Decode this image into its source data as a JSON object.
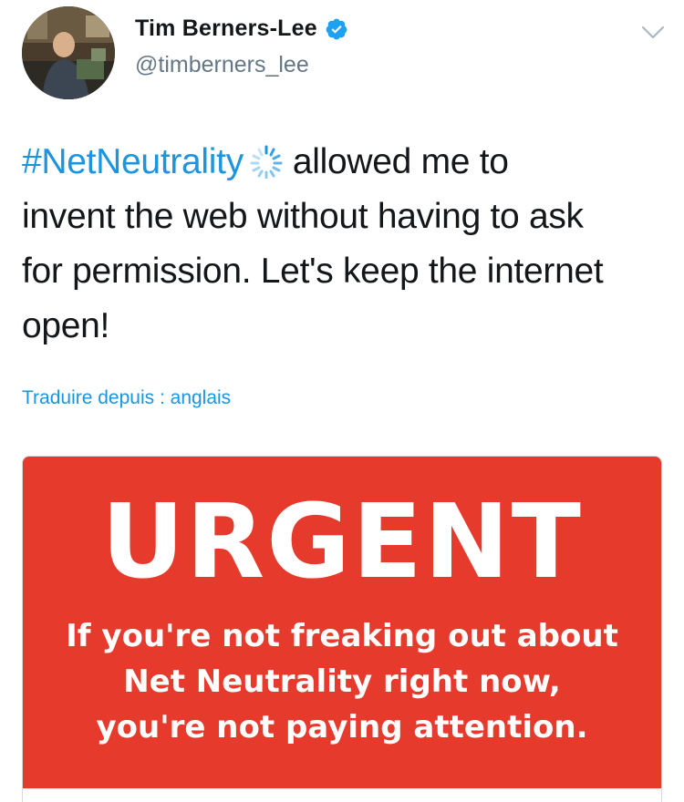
{
  "author": {
    "display_name": "Tim Berners-Lee",
    "handle": "@timberners_lee",
    "verified": true,
    "avatar_icon": "profile-photo"
  },
  "tweet": {
    "hashtag": "#NetNeutrality",
    "hashtag_icon": "spinner-emoji-icon",
    "text_line1_rest": "allowed me to",
    "text_line2": "invent the web without having to ask",
    "text_line3": "for permission. Let's keep the internet",
    "text_line4": "open!",
    "translate_label": "Traduire depuis : anglais"
  },
  "media": {
    "headline": "URGENT",
    "lines": [
      "If you're not freaking out about",
      "Net Neutrality right now,",
      "you're not paying attention."
    ],
    "background_color": "#e63a2c"
  },
  "colors": {
    "accent": "#1b95e0",
    "text": "#14171a",
    "secondary": "#657786"
  }
}
